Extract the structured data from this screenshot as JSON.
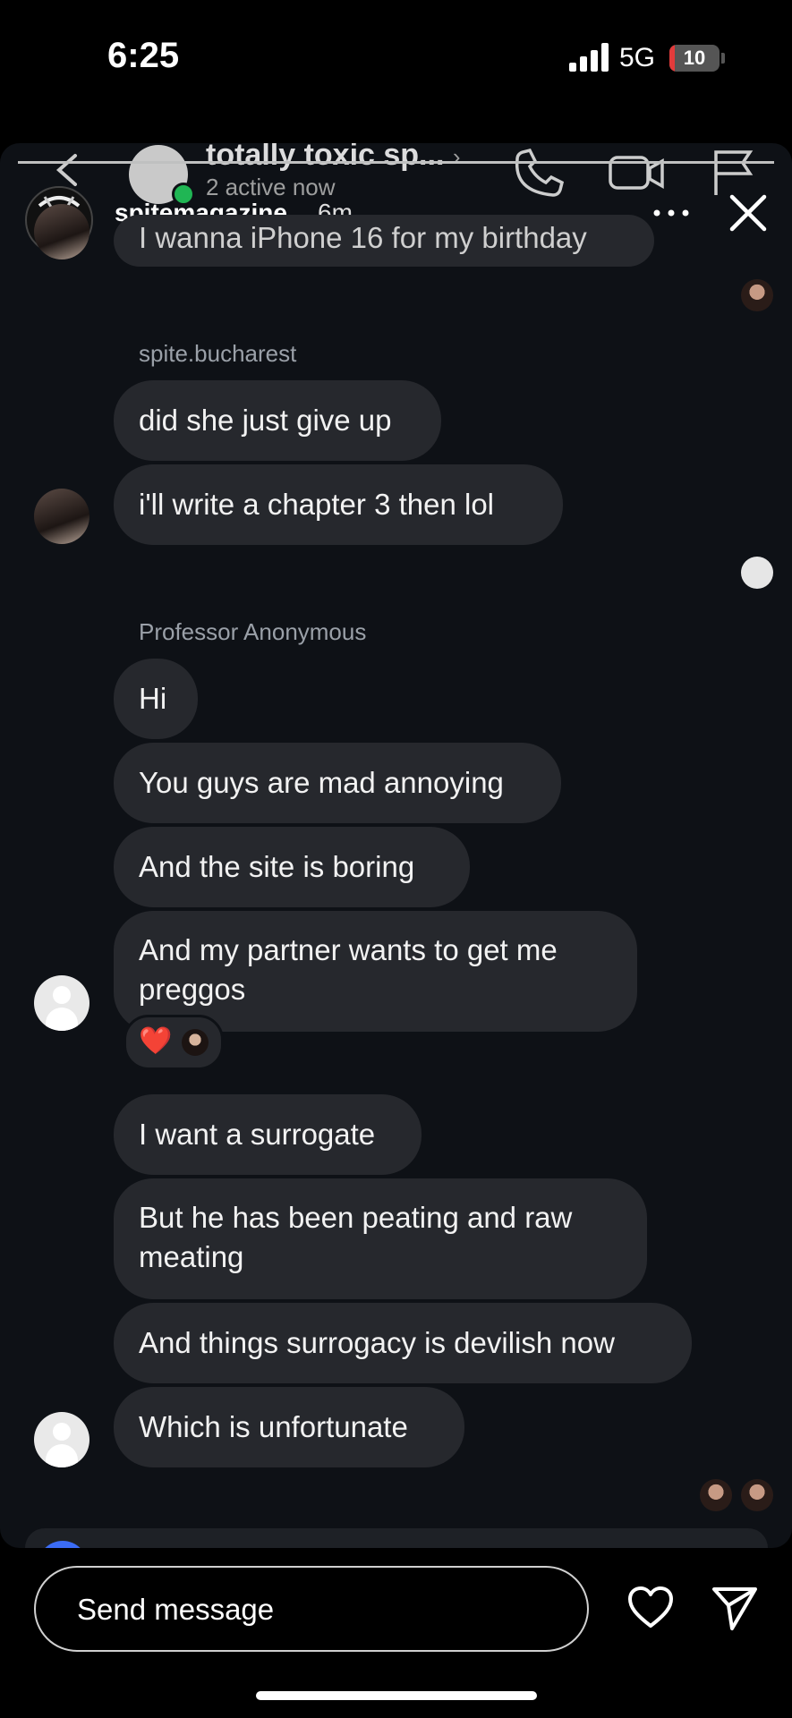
{
  "status_bar": {
    "time": "6:25",
    "network": "5G",
    "battery": "10",
    "battery_level_percent": 10
  },
  "ghost_header": {
    "title": "totally toxic sp...",
    "chevron": "›",
    "subtitle": "2 active now"
  },
  "story": {
    "username": "spitemagazine",
    "age": "6m",
    "partial_message": "I wanna iPhone 16 for my birthday"
  },
  "messages": {
    "sender1": "spite.bucharest",
    "m1": "did she just give up",
    "m2": "i'll write a chapter 3 then lol",
    "sender2": "Professor Anonymous",
    "m3": "Hi",
    "m4": "You guys are mad annoying",
    "m5": "And the site is boring",
    "m6": "And my partner wants to get me preggos",
    "reaction": "❤️",
    "m7": "I want a surrogate",
    "m8": "But he has been peating and raw meating",
    "m9": "And things surrogacy is devilish now",
    "m10": "Which is unfortunate"
  },
  "composer": {
    "placeholder": "Send message"
  },
  "icons": [
    "back-icon",
    "phone-icon",
    "video-icon",
    "flag-icon",
    "more-icon",
    "close-icon",
    "heart-icon",
    "send-icon"
  ]
}
